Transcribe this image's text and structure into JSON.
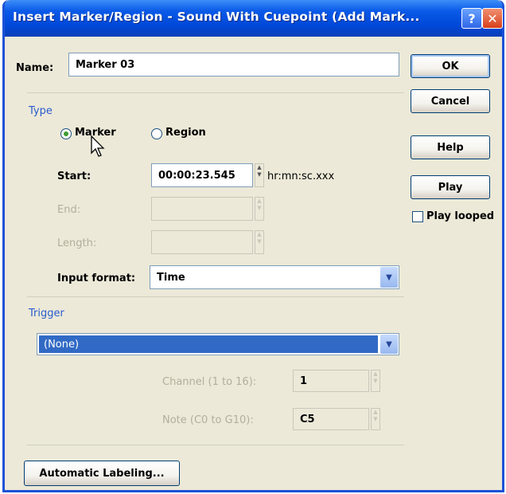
{
  "window": {
    "title": "Insert Marker/Region - Sound With Cuepoint (Add Mark...",
    "help_btn": "?",
    "close_btn": "✕"
  },
  "name": {
    "label": "Name:",
    "value": "Marker 03"
  },
  "buttons": {
    "ok": "OK",
    "cancel": "Cancel",
    "help": "Help",
    "play": "Play",
    "play_looped": "Play looped",
    "automatic_labeling": "Automatic Labeling..."
  },
  "type": {
    "group_label": "Type",
    "marker": "Marker",
    "region": "Region",
    "selected": "Marker"
  },
  "start": {
    "label": "Start:",
    "value": "00:00:23.545",
    "unit": "hr:mn:sc.xxx"
  },
  "end": {
    "label": "End:",
    "value": ""
  },
  "length": {
    "label": "Length:",
    "value": ""
  },
  "input_format": {
    "label": "Input format:",
    "value": "Time"
  },
  "trigger": {
    "group_label": "Trigger",
    "value": "(None)",
    "channel_label": "Channel (1 to 16):",
    "channel_value": "1",
    "note_label": "Note (C0 to G10):",
    "note_value": "C5"
  },
  "colors": {
    "titlebar": "#0a5ae8",
    "window_bg": "#ece9d8",
    "selection": "#316ac5",
    "group_label": "#2a5ccf"
  }
}
